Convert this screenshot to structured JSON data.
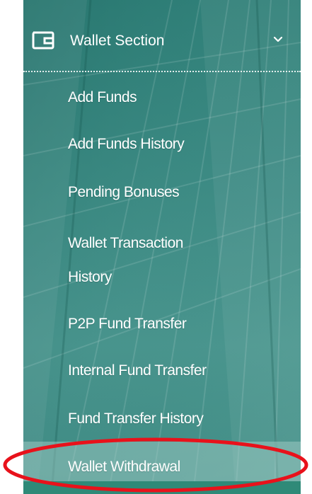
{
  "section": {
    "title": "Wallet Section",
    "icon": "wallet-icon",
    "expand_icon": "chevron-down-icon"
  },
  "menu": {
    "items": [
      {
        "label": "Add Funds"
      },
      {
        "label": "Add Funds History"
      },
      {
        "label": "Pending Bonuses"
      },
      {
        "label": "Wallet Transaction History"
      },
      {
        "label": "P2P Fund Transfer"
      },
      {
        "label": "Internal Fund Transfer"
      },
      {
        "label": "Fund Transfer History"
      },
      {
        "label": "Wallet Withdrawal"
      }
    ]
  },
  "colors": {
    "sidebar_bg": "#3c8a83",
    "active_item_bg": "#a9d1cc",
    "text": "#ffffff",
    "annotation": "#e8121b"
  },
  "annotation": {
    "type": "ellipse",
    "target": "Wallet Withdrawal"
  }
}
